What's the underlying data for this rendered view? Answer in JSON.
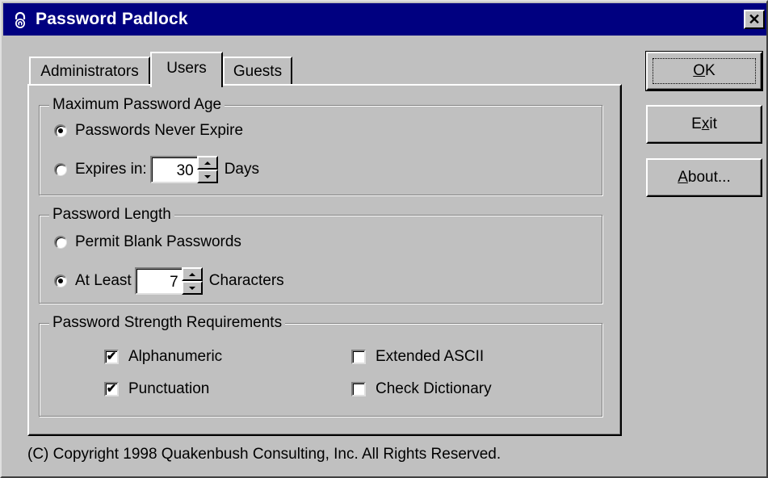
{
  "window": {
    "title": "Password Padlock",
    "close_glyph": "✕",
    "icon": "padlock-icon"
  },
  "tabs": [
    {
      "label": "Administrators",
      "active": false
    },
    {
      "label": "Users",
      "active": true
    },
    {
      "label": "Guests",
      "active": false
    }
  ],
  "max_age": {
    "legend": "Maximum Password Age",
    "never_expire_label": "Passwords Never Expire",
    "never_expire_selected": true,
    "expires_in_label": "Expires in:",
    "expires_in_selected": false,
    "days_value": "30",
    "days_unit": "Days"
  },
  "length": {
    "legend": "Password Length",
    "permit_blank_label": "Permit Blank Passwords",
    "permit_blank_selected": false,
    "at_least_label": "At Least",
    "at_least_selected": true,
    "chars_value": "7",
    "chars_unit": "Characters"
  },
  "strength": {
    "legend": "Password Strength Requirements",
    "alphanumeric": {
      "label": "Alphanumeric",
      "checked": true
    },
    "punctuation": {
      "label": "Punctuation",
      "checked": true
    },
    "extended_ascii": {
      "label": "Extended ASCII",
      "checked": false
    },
    "check_dictionary": {
      "label": "Check Dictionary",
      "checked": false
    }
  },
  "buttons": {
    "ok": {
      "pre": "",
      "mnemonic": "O",
      "post": "K"
    },
    "exit": {
      "pre": "E",
      "mnemonic": "x",
      "post": "it"
    },
    "about": {
      "pre": "",
      "mnemonic": "A",
      "post": "bout..."
    }
  },
  "footer": "(C) Copyright 1998 Quakenbush Consulting, Inc. All Rights Reserved.",
  "check_glyph": "✔"
}
